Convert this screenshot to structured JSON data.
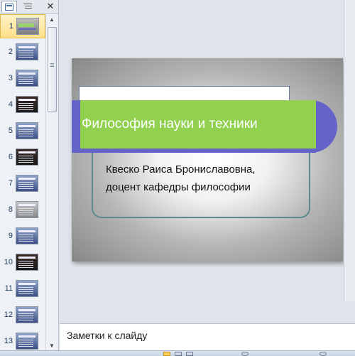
{
  "thumbnail_pane": {
    "close_glyph": "✕",
    "slide_numbers": [
      "1",
      "2",
      "3",
      "4",
      "5",
      "6",
      "7",
      "8",
      "9",
      "10",
      "11",
      "12",
      "13"
    ],
    "selected": "1"
  },
  "slide": {
    "title": "Философия науки и техники",
    "subtitle_line1": "Квеско Раиса Брониславовна,",
    "subtitle_line2": "доцент кафедры философии",
    "colors": {
      "title_bar": "#92d050",
      "accent": "#6464c8",
      "frame": "#5a8a8f"
    }
  },
  "notes": {
    "placeholder": "Заметки к слайду"
  },
  "icons": [
    "slides-tab-icon",
    "outline-tab-icon",
    "close-icon",
    "scroll-up-icon",
    "scroll-down-icon",
    "normal-view-icon"
  ]
}
